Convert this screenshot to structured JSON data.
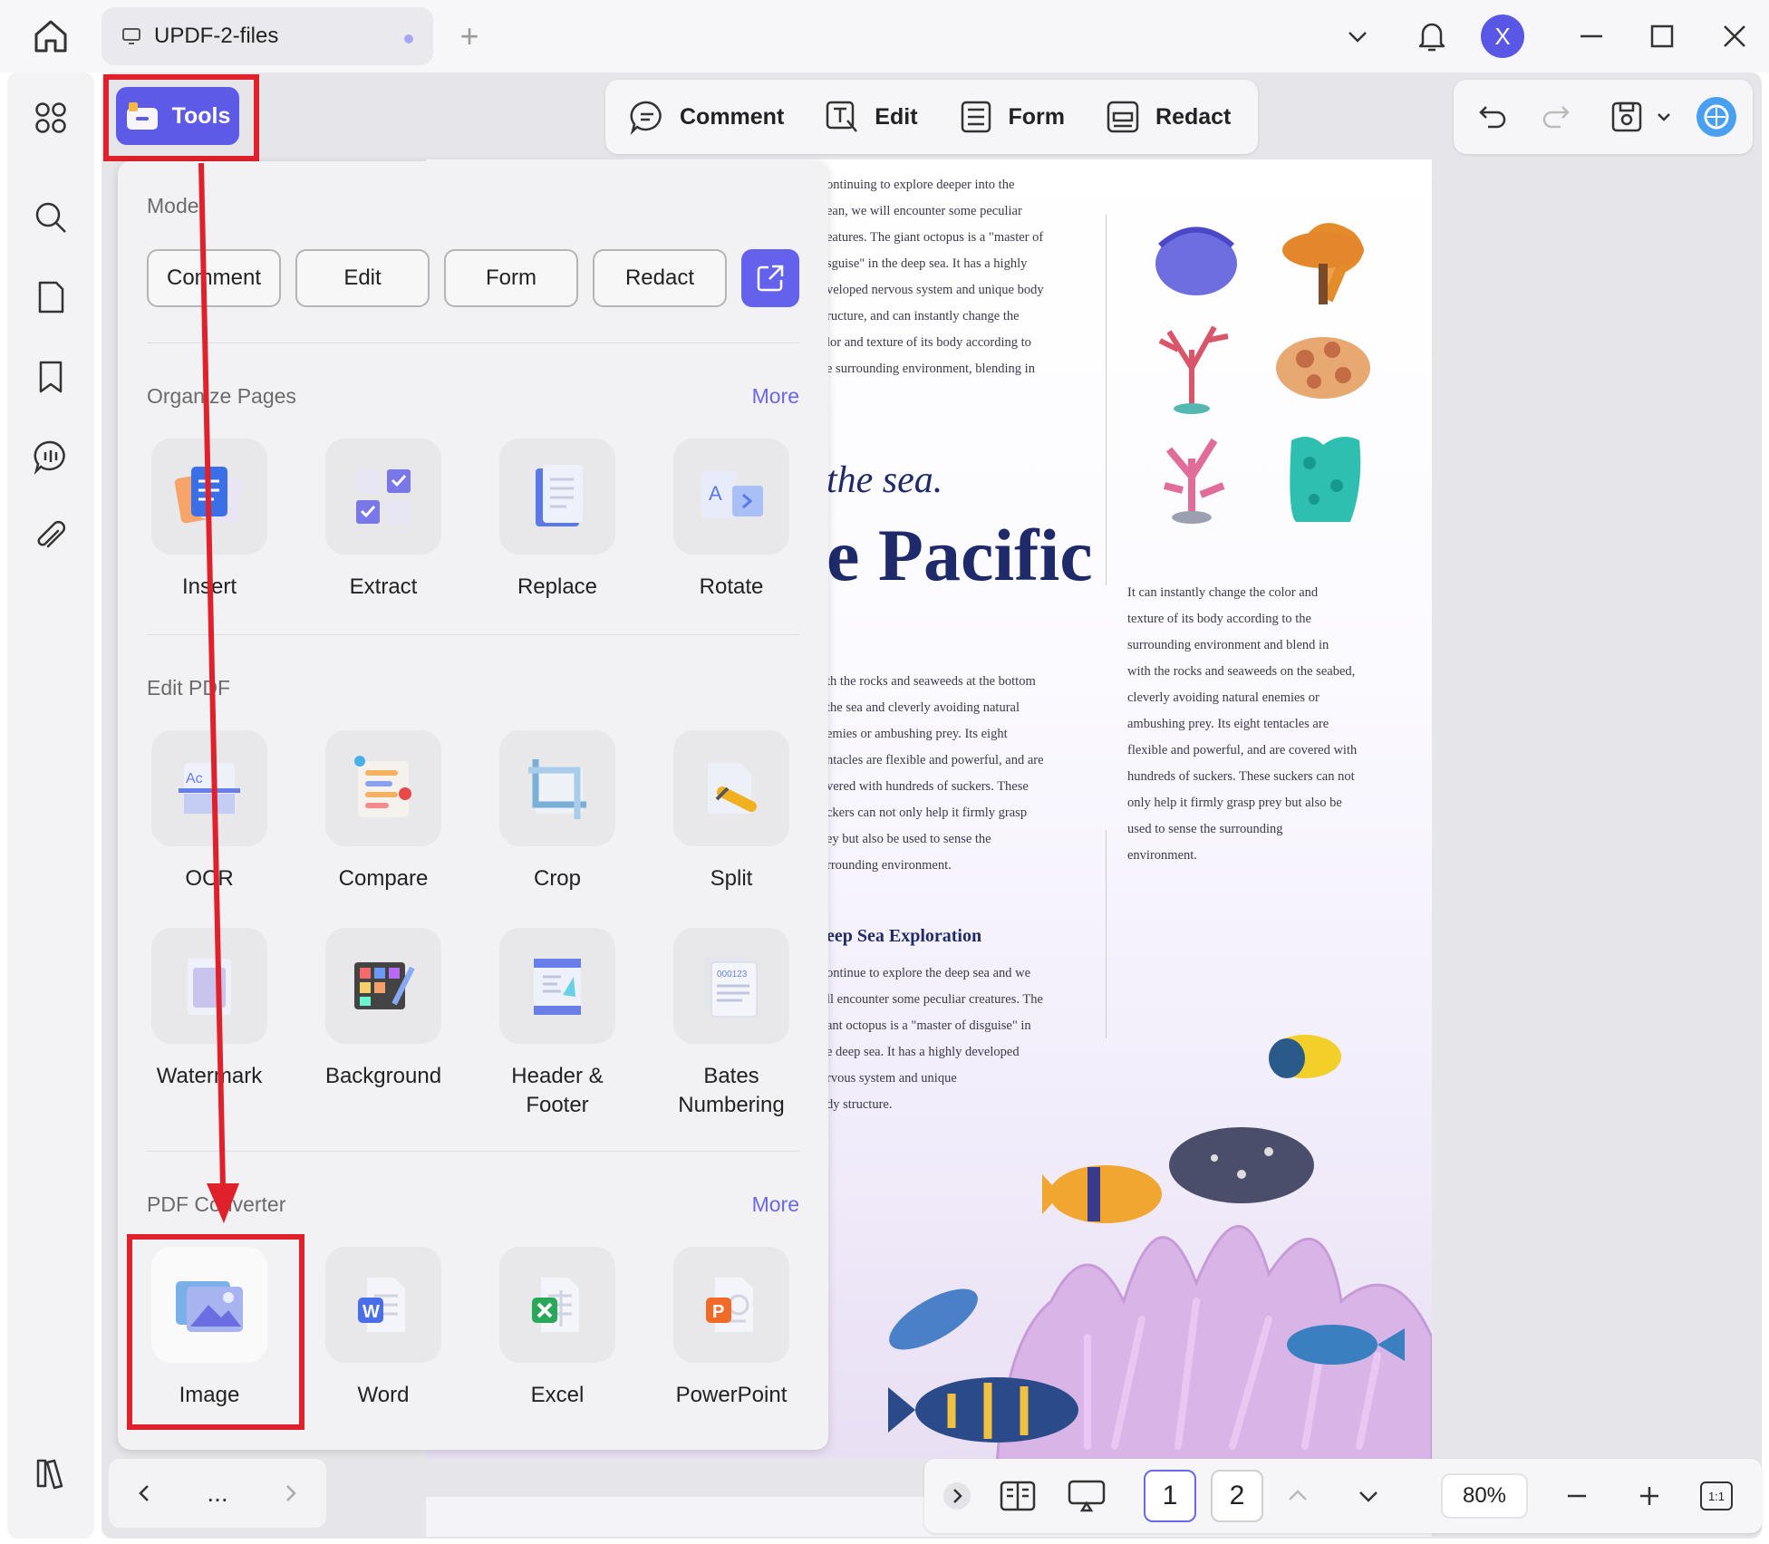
{
  "titlebar": {
    "tab_title": "UPDF-2-files",
    "avatar_letter": "X"
  },
  "tools_button": {
    "label": "Tools"
  },
  "top_toolbar": {
    "items": [
      {
        "label": "Comment",
        "icon": "comment-icon"
      },
      {
        "label": "Edit",
        "icon": "edit-icon"
      },
      {
        "label": "Form",
        "icon": "form-icon"
      },
      {
        "label": "Redact",
        "icon": "redact-icon"
      }
    ]
  },
  "panel": {
    "mode": {
      "title": "Mode",
      "buttons": [
        "Comment",
        "Edit",
        "Form",
        "Redact"
      ]
    },
    "organize": {
      "title": "Organize Pages",
      "more": "More",
      "tools": [
        "Insert",
        "Extract",
        "Replace",
        "Rotate"
      ]
    },
    "edit_pdf": {
      "title": "Edit PDF",
      "tools": [
        "OCR",
        "Compare",
        "Crop",
        "Split",
        "Watermark",
        "Background",
        "Header &\nFooter",
        "Bates\nNumbering"
      ]
    },
    "converter": {
      "title": "PDF Converter",
      "more": "More",
      "tools": [
        "Image",
        "Word",
        "Excel",
        "PowerPoint"
      ]
    }
  },
  "document": {
    "col1_top": [
      "ontinuing to explore deeper into the",
      "ean, we will encounter some peculiar",
      "eatures. The giant octopus is a \"master of",
      "sguise\" in the deep sea. It has a highly",
      "veloped nervous system and unique body",
      "ructure, and can instantly change the",
      "lor and texture of its body according to",
      "e surrounding environment, blending in"
    ],
    "headline_small": "the sea.",
    "headline_big": "e Pacific",
    "col1_mid": [
      "th the rocks and seaweeds at the bottom",
      " the sea and cleverly avoiding natural",
      "emies or ambushing prey. Its eight",
      "ntacles are flexible and powerful, and are",
      "vered with hundreds of suckers. These",
      "ckers can not only help it firmly grasp",
      "ey but also be used to sense the",
      "rrounding environment."
    ],
    "section_heading": "eep Sea Exploration",
    "col1_bottom": [
      "ontinue to explore the deep sea and we",
      "ll encounter some peculiar creatures. The",
      "ant octopus is a \"master of disguise\" in",
      "e deep sea. It has a highly developed",
      "rvous system and unique",
      "dy structure."
    ],
    "col2": [
      "It can instantly change the color and",
      "texture of its body according to the",
      "surrounding environment and blend in",
      "with the rocks and seaweeds on the seabed,",
      "cleverly avoiding natural enemies or",
      "ambushing prey. Its eight tentacles are",
      "flexible and powerful, and are covered with",
      "hundreds of suckers. These suckers can not",
      "only help it firmly grasp prey but also be",
      "used to sense the surrounding",
      "environment."
    ]
  },
  "bottom_bar": {
    "nav_dots": "...",
    "pages": [
      "1",
      "2"
    ],
    "zoom": "80%",
    "fit_label": "1:1"
  },
  "colors": {
    "accent": "#5d5ae8",
    "highlight_red": "#e0202a",
    "more_link": "#6a68e8"
  }
}
